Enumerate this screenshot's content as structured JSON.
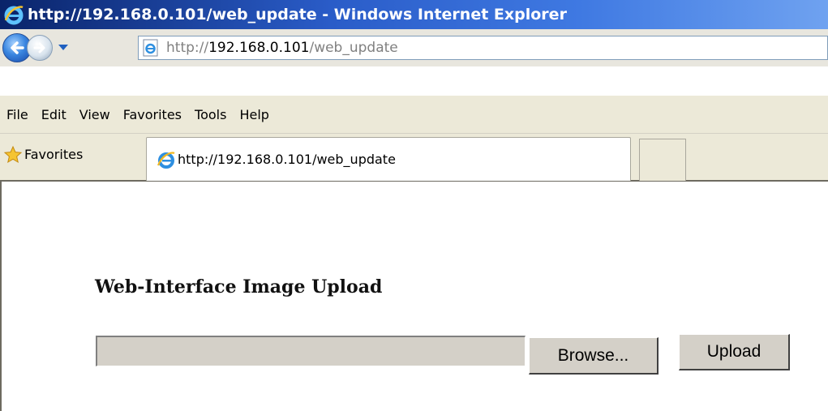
{
  "window": {
    "title": "http://192.168.0.101/web_update - Windows Internet Explorer"
  },
  "address_bar": {
    "prefix": "http://",
    "host": "192.168.0.101",
    "path": "/web_update"
  },
  "menu": {
    "items": [
      "File",
      "Edit",
      "View",
      "Favorites",
      "Tools",
      "Help"
    ]
  },
  "favorites_bar": {
    "label": "Favorites",
    "tab_title": "http://192.168.0.101/web_update"
  },
  "page": {
    "heading": "Web-Interface Image Upload",
    "file_input_value": "",
    "browse_label": "Browse...",
    "upload_label": "Upload"
  },
  "icons": {
    "title": "ie-logo-icon",
    "back": "back-arrow-icon",
    "forward": "forward-arrow-icon",
    "history": "dropdown-arrow-icon",
    "page": "ie-page-icon",
    "favorites": "star-icon",
    "tab": "ie-logo-icon"
  },
  "colors": {
    "titlebar": "#0a246a",
    "chrome": "#ece9d8",
    "button_face": "#d4d0c8"
  }
}
